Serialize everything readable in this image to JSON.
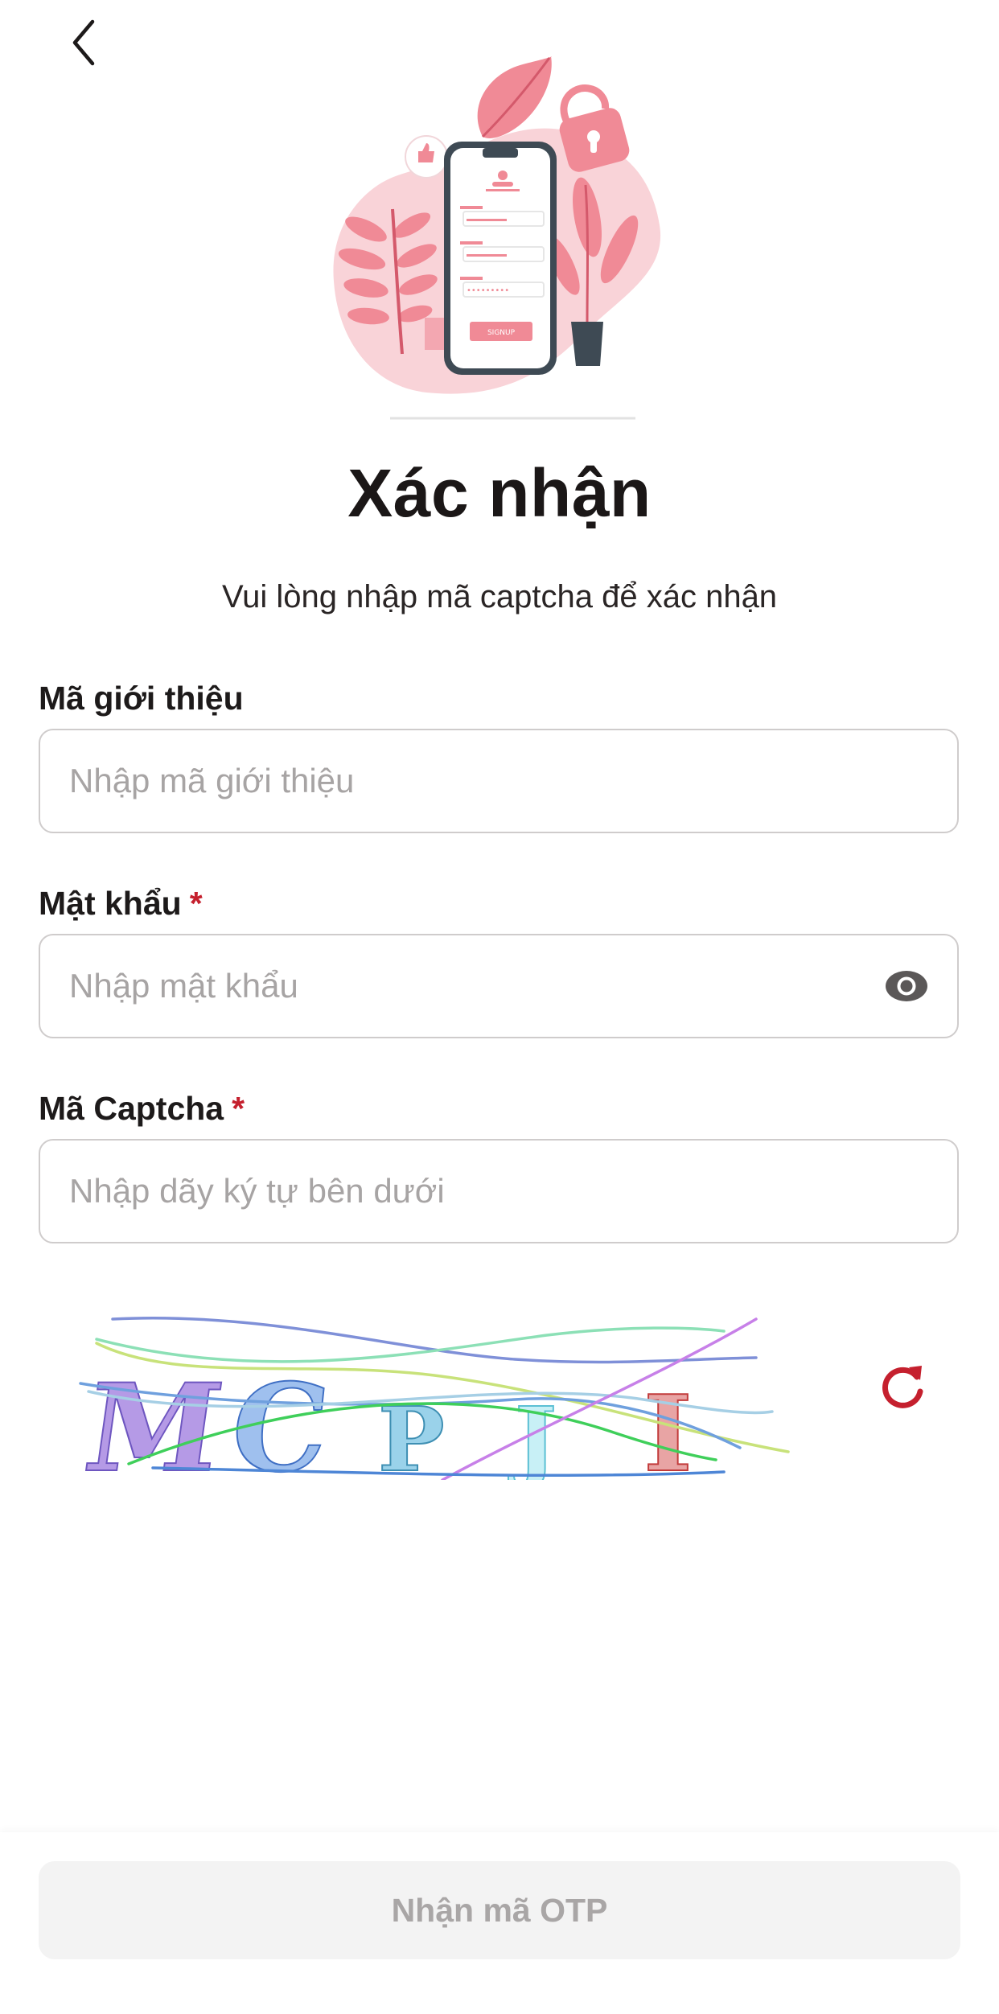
{
  "header": {
    "back_icon": "chevron-left-icon"
  },
  "page": {
    "title": "Xác nhận",
    "subtitle": "Vui lòng nhập mã captcha để xác nhận"
  },
  "form": {
    "referral": {
      "label": "Mã giới thiệu",
      "placeholder": "Nhập mã giới thiệu",
      "value": ""
    },
    "password": {
      "label": "Mật khẩu",
      "required_mark": "*",
      "placeholder": "Nhập mật khẩu",
      "value": "",
      "toggle_icon": "eye-icon"
    },
    "captcha": {
      "label": "Mã Captcha",
      "required_mark": "*",
      "placeholder": "Nhập dãy ký tự bên dưới",
      "value": "",
      "image_text": "MCPJI",
      "refresh_icon": "refresh-icon"
    }
  },
  "footer": {
    "submit_label": "Nhận mã OTP"
  },
  "colors": {
    "accent": "#c5202e",
    "illustration_pink": "#f08a96",
    "disabled_bg": "#f3f3f3",
    "disabled_text": "#a9a6a6"
  }
}
